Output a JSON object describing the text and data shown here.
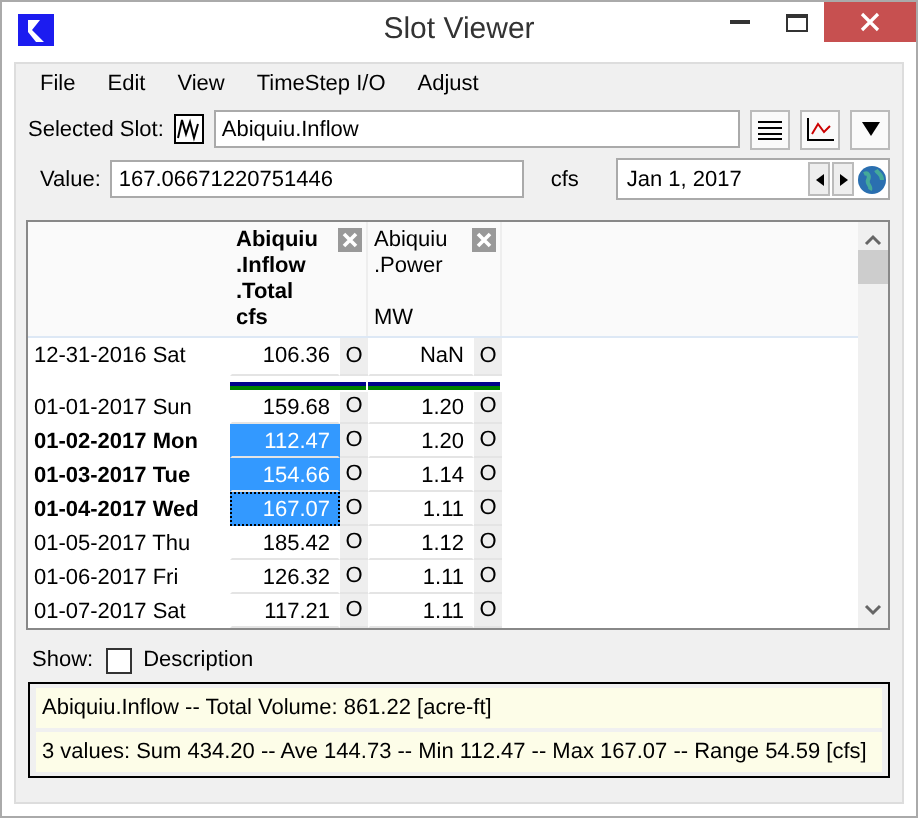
{
  "window": {
    "title": "Slot Viewer"
  },
  "menu": [
    "File",
    "Edit",
    "View",
    "TimeStep I/O",
    "Adjust"
  ],
  "selected_slot": {
    "label": "Selected Slot:",
    "value": "Abiquiu.Inflow"
  },
  "value_row": {
    "label": "Value:",
    "value": "167.06671220751446",
    "unit": "cfs",
    "date": "Jan 1, 2017"
  },
  "table": {
    "columns": [
      {
        "lines": [
          "Abiquiu",
          ".Inflow",
          ".Total"
        ],
        "unit": "cfs",
        "bold": true
      },
      {
        "lines": [
          "Abiquiu",
          ".Power"
        ],
        "unit": "MW",
        "bold": false
      }
    ],
    "initial_row": {
      "date": "12-31-2016 Sat",
      "values": [
        "106.36",
        "NaN"
      ],
      "flags": [
        "O",
        "O"
      ]
    },
    "rows": [
      {
        "date": "01-01-2017 Sun",
        "values": [
          "159.68",
          "1.20"
        ],
        "flags": [
          "O",
          "O"
        ],
        "selected": false,
        "focused": false
      },
      {
        "date": "01-02-2017 Mon",
        "values": [
          "112.47",
          "1.20"
        ],
        "flags": [
          "O",
          "O"
        ],
        "selected": true,
        "focused": false
      },
      {
        "date": "01-03-2017 Tue",
        "values": [
          "154.66",
          "1.14"
        ],
        "flags": [
          "O",
          "O"
        ],
        "selected": true,
        "focused": false
      },
      {
        "date": "01-04-2017 Wed",
        "values": [
          "167.07",
          "1.11"
        ],
        "flags": [
          "O",
          "O"
        ],
        "selected": true,
        "focused": true
      },
      {
        "date": "01-05-2017 Thu",
        "values": [
          "185.42",
          "1.12"
        ],
        "flags": [
          "O",
          "O"
        ],
        "selected": false,
        "focused": false
      },
      {
        "date": "01-06-2017 Fri",
        "values": [
          "126.32",
          "1.11"
        ],
        "flags": [
          "O",
          "O"
        ],
        "selected": false,
        "focused": false
      },
      {
        "date": "01-07-2017 Sat",
        "values": [
          "117.21",
          "1.11"
        ],
        "flags": [
          "O",
          "O"
        ],
        "selected": false,
        "focused": false
      }
    ]
  },
  "show": {
    "label": "Show:",
    "option": "Description",
    "checked": false
  },
  "summary": [
    "Abiquiu.Inflow -- Total Volume: 861.22 [acre-ft]",
    "3 values:  Sum 434.20 -- Ave 144.73 -- Min 112.47 -- Max 167.07 -- Range 54.59 [cfs]"
  ]
}
